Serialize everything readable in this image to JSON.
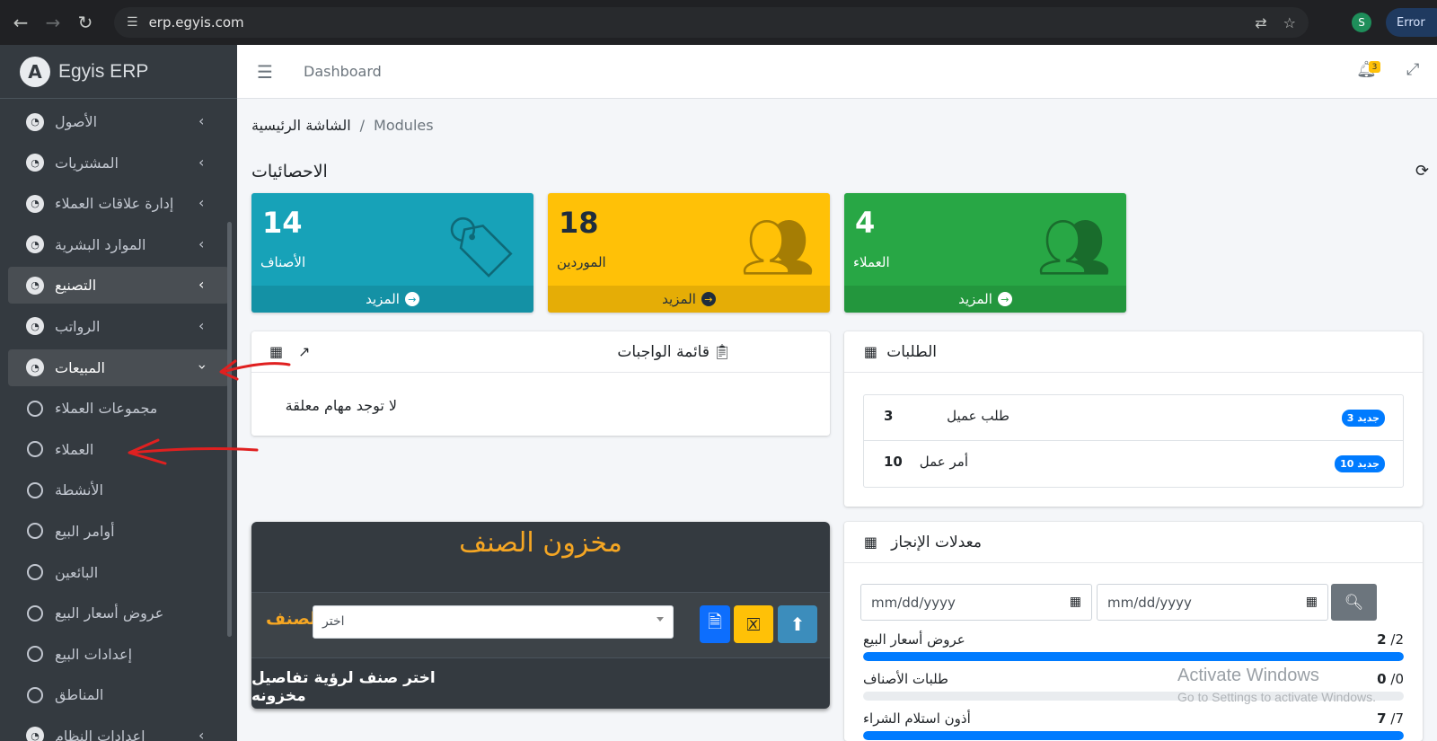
{
  "browser": {
    "url": "erp.egyis.com",
    "profile_initial": "S",
    "error_label": "Error"
  },
  "brand": {
    "logo_letter": "A",
    "name": "Egyis ERP"
  },
  "sidebar": {
    "items": [
      {
        "label": "الأصول"
      },
      {
        "label": "المشتريات"
      },
      {
        "label": "إدارة علاقات العملاء"
      },
      {
        "label": "الموارد البشرية"
      },
      {
        "label": "التصنيع"
      },
      {
        "label": "الرواتب"
      },
      {
        "label": "المبيعات"
      }
    ],
    "subitems": [
      {
        "label": "مجموعات العملاء"
      },
      {
        "label": "العملاء"
      },
      {
        "label": "الأنشطة"
      },
      {
        "label": "أوامر البيع"
      },
      {
        "label": "البائعين"
      },
      {
        "label": "عروض أسعار البيع"
      },
      {
        "label": "إعدادات البيع"
      },
      {
        "label": "المناطق"
      }
    ],
    "partial_item": "إعدادات النظام"
  },
  "navbar": {
    "link": "Dashboard",
    "bell_count": "3"
  },
  "breadcrumb": {
    "home": "الشاشة الرئيسية",
    "separator": "/",
    "current": "Modules"
  },
  "stats": {
    "title": "الاحصائيات",
    "boxes": [
      {
        "number": "14",
        "label": "الأصناف",
        "more": "المزيد"
      },
      {
        "number": "18",
        "label": "الموردين",
        "more": "المزيد"
      },
      {
        "number": "4",
        "label": "العملاء",
        "more": "المزيد"
      }
    ]
  },
  "todo": {
    "title": "قائمة الواجبات",
    "empty": "لا توجد مهام معلقة"
  },
  "requests": {
    "title": "الطلبات",
    "rows": [
      {
        "text": "طلب عميل",
        "count": "3",
        "badge": "جديد 3"
      },
      {
        "text": "أمر عمل",
        "count": "10",
        "badge": "جديد 10"
      }
    ]
  },
  "stock": {
    "title": "مخزون الصنف",
    "label": "الصنف",
    "select_value": "اختر",
    "hint": "اختر صنف لرؤية تفاصيل مخزونه"
  },
  "rates": {
    "title": "معدلات الإنجاز",
    "date_placeholder": "mm/dd/yyyy",
    "rows": [
      {
        "label": "عروض أسعار البيع",
        "done": "2",
        "total": "/2",
        "fraction": 1.0
      },
      {
        "label": "طلبات الأصناف",
        "done": "0",
        "total": "/0",
        "fraction": 0.0
      },
      {
        "label": "أذون استلام الشراء",
        "done": "7",
        "total": "/7",
        "fraction": 1.0
      }
    ]
  },
  "watermark": {
    "title": "Activate Windows",
    "sub": "Go to Settings to activate Windows."
  }
}
